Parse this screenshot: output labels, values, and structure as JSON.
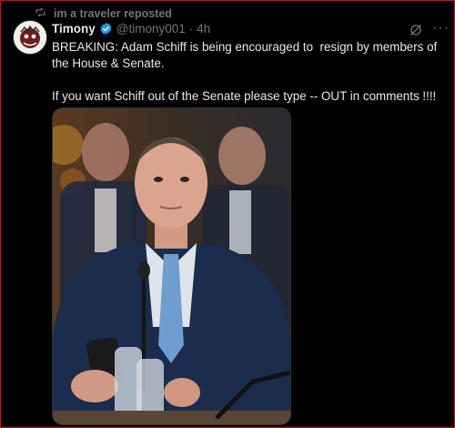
{
  "repost": {
    "text": "im a traveler reposted",
    "icon": "repost-icon"
  },
  "author": {
    "name": "Timony",
    "handle": "@timony001",
    "separator": "·",
    "time": "4h",
    "verified_color": "#1d9bf0"
  },
  "actions": {
    "grok_icon": "grok-icon",
    "more": "···"
  },
  "post": {
    "line1": "BREAKING: Adam Schiff is being encouraged to  resign by members of the House & Senate.",
    "line2": "If you want Schiff out of the Senate please type -- OUT in comments !!!!"
  },
  "media": {
    "type": "photo"
  },
  "colors": {
    "border": "#c01818",
    "muted": "#71767b",
    "text": "#e7e9ea"
  }
}
